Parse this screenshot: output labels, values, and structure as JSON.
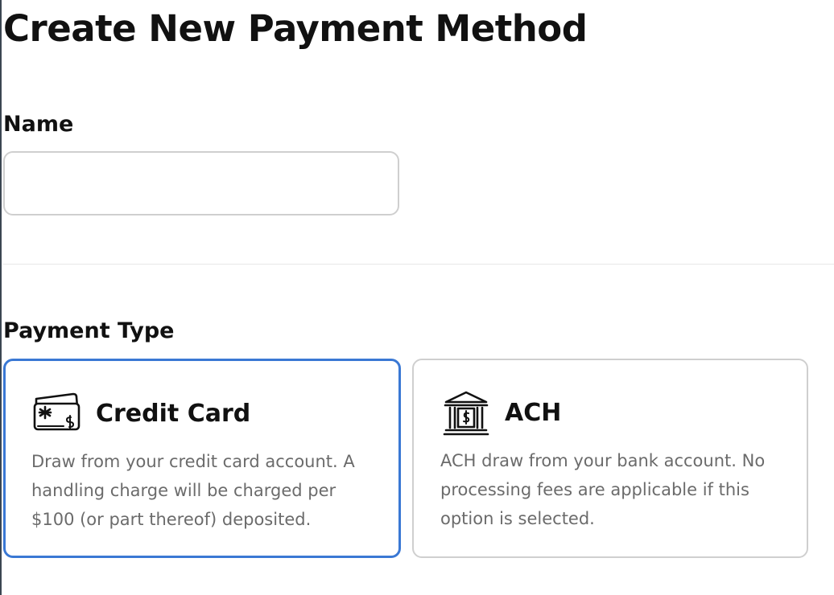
{
  "page": {
    "title": "Create New Payment Method"
  },
  "form": {
    "name_label": "Name",
    "name_value": "",
    "payment_type_label": "Payment Type"
  },
  "payment_options": [
    {
      "title": "Credit Card",
      "description": "Draw from your credit card account. A handling charge will be charged per $100 (or part thereof) deposited.",
      "icon": "credit-card-icon",
      "selected": true
    },
    {
      "title": "ACH",
      "description": "ACH draw from your bank account. No processing fees are applicable if this option is selected.",
      "icon": "bank-icon",
      "selected": false
    }
  ],
  "colors": {
    "selected_border": "#3a78d4",
    "unselected_border": "#cfcfcf",
    "description_text": "#6b6b6b",
    "heading_text": "#111111"
  }
}
